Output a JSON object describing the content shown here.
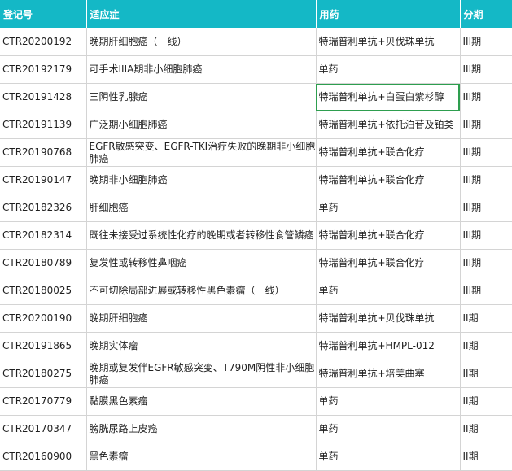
{
  "headers": [
    "登记号",
    "适应症",
    "用药",
    "分期"
  ],
  "rows": [
    {
      "id": "CTR20200192",
      "indication": "晚期肝细胞癌（一线）",
      "drug": "特瑞普利单抗+贝伐珠单抗",
      "phase": "III期"
    },
    {
      "id": "CTR20192179",
      "indication": "可手术IIIA期非小细胞肺癌",
      "drug": "单药",
      "phase": "III期"
    },
    {
      "id": "CTR20191428",
      "indication": "三阴性乳腺癌",
      "drug": "特瑞普利单抗+白蛋白紫杉醇",
      "phase": "III期"
    },
    {
      "id": "CTR20191139",
      "indication": "广泛期小细胞肺癌",
      "drug": "特瑞普利单抗+依托泊苷及铂类",
      "phase": "III期"
    },
    {
      "id": "CTR20190768",
      "indication": "EGFR敏感突变、EGFR-TKI治疗失败的晚期非小细胞肺癌",
      "drug": "特瑞普利单抗+联合化疗",
      "phase": "III期"
    },
    {
      "id": "CTR20190147",
      "indication": "晚期非小细胞肺癌",
      "drug": "特瑞普利单抗+联合化疗",
      "phase": "III期"
    },
    {
      "id": "CTR20182326",
      "indication": "肝细胞癌",
      "drug": "单药",
      "phase": "III期"
    },
    {
      "id": "CTR20182314",
      "indication": "既往未接受过系统性化疗的晚期或者转移性食管鳞癌",
      "drug": "特瑞普利单抗+联合化疗",
      "phase": "III期"
    },
    {
      "id": "CTR20180789",
      "indication": "复发性或转移性鼻咽癌",
      "drug": "特瑞普利单抗+联合化疗",
      "phase": "III期"
    },
    {
      "id": "CTR20180025",
      "indication": "不可切除局部进展或转移性黑色素瘤（一线）",
      "drug": "单药",
      "phase": "III期"
    },
    {
      "id": "CTR20200190",
      "indication": "晚期肝细胞癌",
      "drug": "特瑞普利单抗+贝伐珠单抗",
      "phase": "II期"
    },
    {
      "id": "CTR20191865",
      "indication": "晚期实体瘤",
      "drug": "特瑞普利单抗+HMPL-012",
      "phase": "II期"
    },
    {
      "id": "CTR20180275",
      "indication": "晚期或复发伴EGFR敏感突变、T790M阴性非小细胞肺癌",
      "drug": "特瑞普利单抗+培美曲塞",
      "phase": "II期"
    },
    {
      "id": "CTR20170779",
      "indication": "黏膜黑色素瘤",
      "drug": "单药",
      "phase": "II期"
    },
    {
      "id": "CTR20170347",
      "indication": "膀胱尿路上皮癌",
      "drug": "单药",
      "phase": "II期"
    },
    {
      "id": "CTR20160900",
      "indication": "黑色素瘤",
      "drug": "单药",
      "phase": "II期"
    }
  ],
  "colors": {
    "header_bg": "#14b8c6",
    "grid": "#d4d4d4",
    "selection": "#2e9e4f"
  }
}
